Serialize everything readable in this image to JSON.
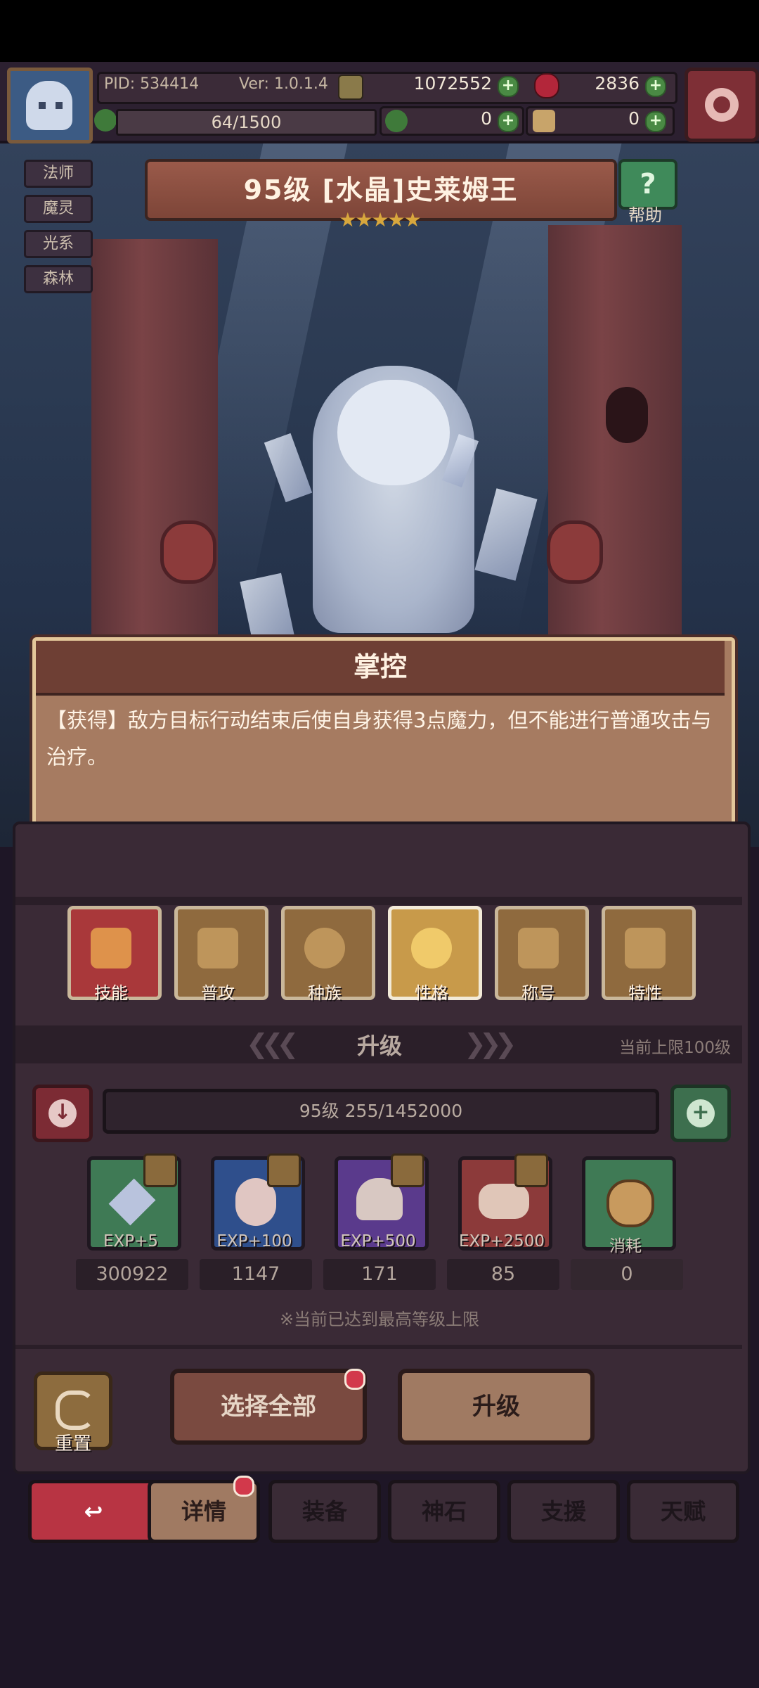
{
  "header": {
    "pid": "PID: 534414",
    "version": "Ver: 1.0.1.4",
    "gold": "1072552",
    "gems": "2836",
    "exp_bar": "64/1500",
    "clover_count": "0",
    "item_count": "0"
  },
  "tags": [
    "法师",
    "魔灵",
    "光系",
    "森林"
  ],
  "character": {
    "title": "95级 [水晶]史莱姆王",
    "stars": "★★★★★",
    "help_label": "帮助"
  },
  "tooltip": {
    "title": "掌控",
    "text": "【获得】敌方目标行动结束后使自身获得3点魔力，但不能进行普通攻击与治疗。"
  },
  "tabs": [
    "技能",
    "普攻",
    "种族",
    "性格",
    "称号",
    "特性"
  ],
  "upgrade": {
    "section_title": "升级",
    "cap_note": "当前上限100级",
    "level_progress": "95级 255/1452000",
    "items": [
      {
        "label": "EXP+5",
        "count": "300922"
      },
      {
        "label": "EXP+100",
        "count": "1147"
      },
      {
        "label": "EXP+500",
        "count": "171"
      },
      {
        "label": "EXP+2500",
        "count": "85"
      },
      {
        "label": "消耗",
        "count": "0"
      }
    ],
    "max_note": "※当前已达到最高等级上限",
    "reset_label": "重置",
    "select_all_label": "选择全部",
    "upgrade_label": "升级"
  },
  "bottom_nav": [
    "详情",
    "装备",
    "神石",
    "支援",
    "天赋"
  ],
  "colors": {
    "panel": "#3a2a36",
    "tooltip": "#a67b61",
    "accent_red": "#d2394b",
    "green": "#3d6f4e"
  }
}
